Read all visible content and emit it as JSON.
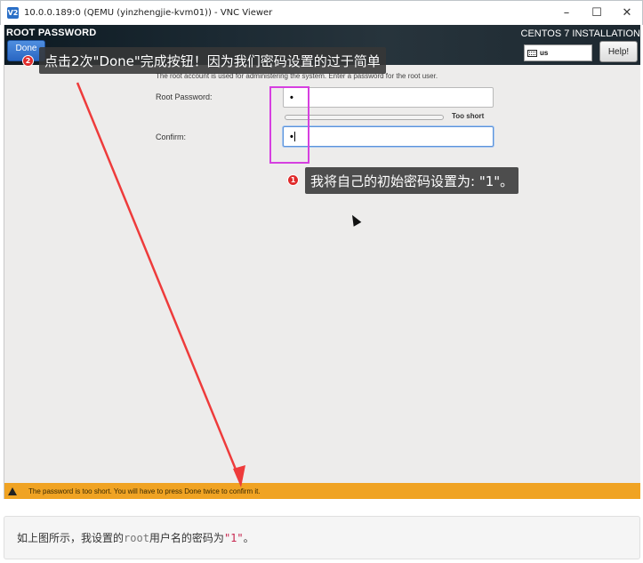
{
  "window": {
    "icon_text": "V2",
    "title": "10.0.0.189:0 (QEMU (yinzhengjie-kvm01)) - VNC Viewer",
    "controls": {
      "minimize": "–",
      "maximize": "☐",
      "close": "✕"
    }
  },
  "header": {
    "spoke_title": "ROOT PASSWORD",
    "done_label": "Done",
    "product_title": "CENTOS 7 INSTALLATION",
    "keyboard_layout": "us",
    "help_label": "Help!"
  },
  "form": {
    "intro": "The root account is used for administering the system.  Enter a password for the root user.",
    "root_password_label": "Root Password:",
    "root_password_value": "•",
    "strength_label": "Too short",
    "strength_fraction": 0,
    "confirm_label": "Confirm:",
    "confirm_value": "•"
  },
  "warning": {
    "text": "The password is too short. You will have to press Done twice to confirm it."
  },
  "annotations": {
    "bubble_top_badge": "2",
    "bubble_top_text": "点击2次\"Done\"完成按钮！因为我们密码设置的过于简单",
    "bubble_mid_badge": "1",
    "bubble_mid_text": "我将自己的初始密码设置为: \"1\"。",
    "arrow_color": "#ee3b3b",
    "highlight_color": "#d63fe0"
  },
  "caption": {
    "prefix": "如上图所示，我设置的",
    "code_user": "root",
    "middle": "用户名的密码为",
    "code_value": "\"1\"",
    "suffix": "。"
  }
}
